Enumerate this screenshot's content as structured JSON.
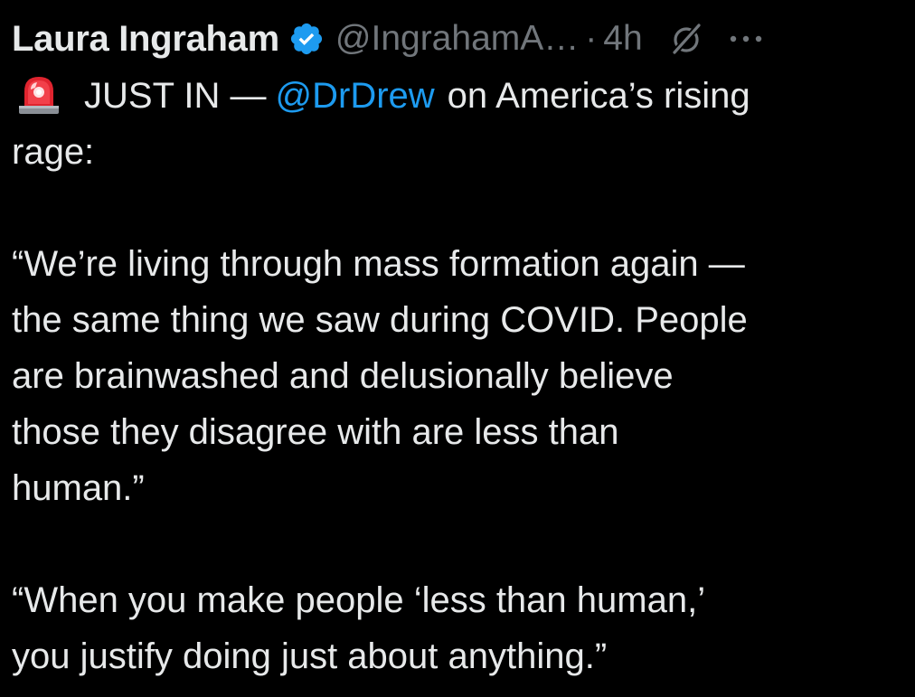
{
  "tweet": {
    "author_name": "Laura Ingraham",
    "handle": "@IngrahamA…",
    "separator": "·",
    "time": "4h",
    "verified_color": "#1d9bf0",
    "icons": {
      "verified": "verified-badge-icon",
      "grok": "grok-icon",
      "more": "more-options-icon",
      "siren": "police-siren-emoji"
    },
    "line1_prefix": "JUST IN —",
    "mention": "@DrDrew",
    "line1_suffix": "on America’s rising",
    "line2": "rage:",
    "paragraph2": [
      "“We’re living through mass formation again —",
      "the same thing we saw during COVID. People",
      "are brainwashed and delusionally believe",
      "those they disagree with are less than",
      "human.”"
    ],
    "paragraph3": [
      "“When you make people ‘less than human,’",
      "you justify doing just about anything.”"
    ]
  },
  "colors": {
    "background": "#000000",
    "text": "#e7e9ea",
    "secondary": "#71767b",
    "link": "#1d9bf0"
  }
}
